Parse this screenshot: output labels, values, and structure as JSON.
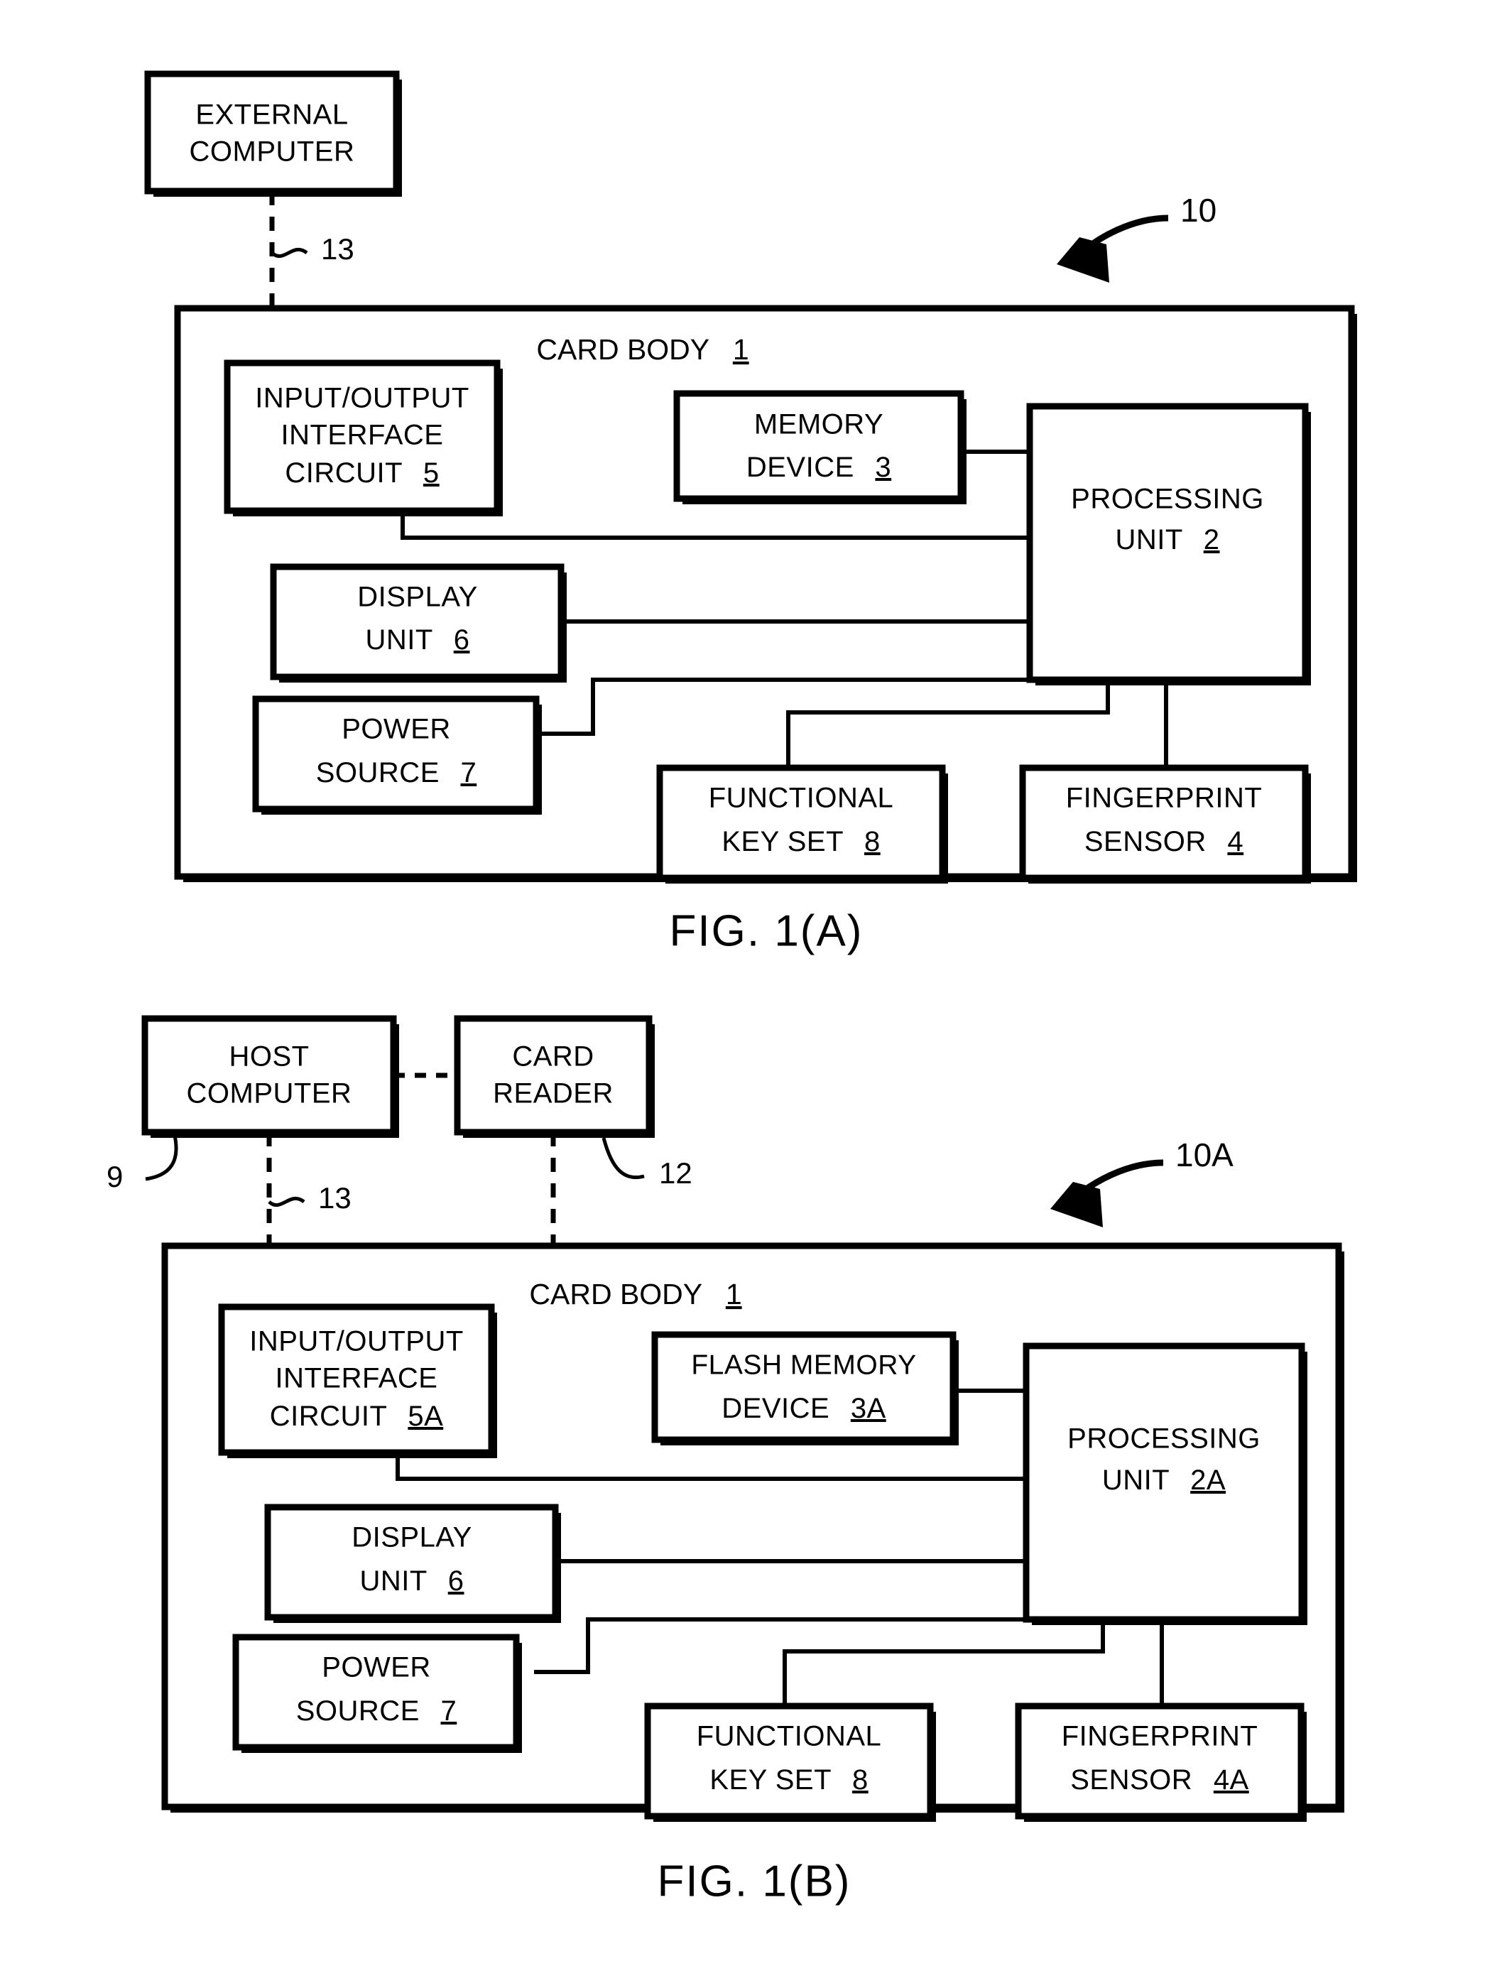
{
  "figures": [
    {
      "id": "fig-1a",
      "caption": "FIG. 1(A)",
      "external_box": {
        "line1": "EXTERNAL",
        "line2": "COMPUTER"
      },
      "card_body_label": "CARD BODY",
      "card_body_ref": "1",
      "assembly_ref": "10",
      "link_ref": "13",
      "blocks": [
        {
          "name": "io-interface",
          "line1": "INPUT/OUTPUT",
          "line2": "INTERFACE",
          "line3": "CIRCUIT",
          "ref": "5"
        },
        {
          "name": "memory-device",
          "line1": "MEMORY",
          "line2": "DEVICE",
          "ref": "3"
        },
        {
          "name": "processing-unit",
          "line1": "PROCESSING",
          "line2": "UNIT",
          "ref": "2"
        },
        {
          "name": "display-unit",
          "line1": "DISPLAY",
          "line2": "UNIT",
          "ref": "6"
        },
        {
          "name": "power-source",
          "line1": "POWER",
          "line2": "SOURCE",
          "ref": "7"
        },
        {
          "name": "functional-key-set",
          "line1": "FUNCTIONAL",
          "line2": "KEY SET",
          "ref": "8"
        },
        {
          "name": "fingerprint-sensor",
          "line1": "FINGERPRINT",
          "line2": "SENSOR",
          "ref": "4"
        }
      ]
    },
    {
      "id": "fig-1b",
      "caption": "FIG. 1(B)",
      "host_box": {
        "line1": "HOST",
        "line2": "COMPUTER",
        "ref": "9"
      },
      "reader_box": {
        "line1": "CARD",
        "line2": "READER",
        "ref": "12"
      },
      "card_body_label": "CARD BODY",
      "card_body_ref": "1",
      "assembly_ref": "10A",
      "link_ref": "13",
      "blocks": [
        {
          "name": "io-interface",
          "line1": "INPUT/OUTPUT",
          "line2": "INTERFACE",
          "line3": "CIRCUIT",
          "ref": "5A"
        },
        {
          "name": "flash-memory-device",
          "line1": "FLASH MEMORY",
          "line2": "DEVICE",
          "ref": "3A"
        },
        {
          "name": "processing-unit",
          "line1": "PROCESSING",
          "line2": "UNIT",
          "ref": "2A"
        },
        {
          "name": "display-unit",
          "line1": "DISPLAY",
          "line2": "UNIT",
          "ref": "6"
        },
        {
          "name": "power-source",
          "line1": "POWER",
          "line2": "SOURCE",
          "ref": "7"
        },
        {
          "name": "functional-key-set",
          "line1": "FUNCTIONAL",
          "line2": "KEY SET",
          "ref": "8"
        },
        {
          "name": "fingerprint-sensor",
          "line1": "FINGERPRINT",
          "line2": "SENSOR",
          "ref": "4A"
        }
      ]
    }
  ],
  "colors": {
    "ink": "#000000",
    "paper": "#ffffff"
  }
}
